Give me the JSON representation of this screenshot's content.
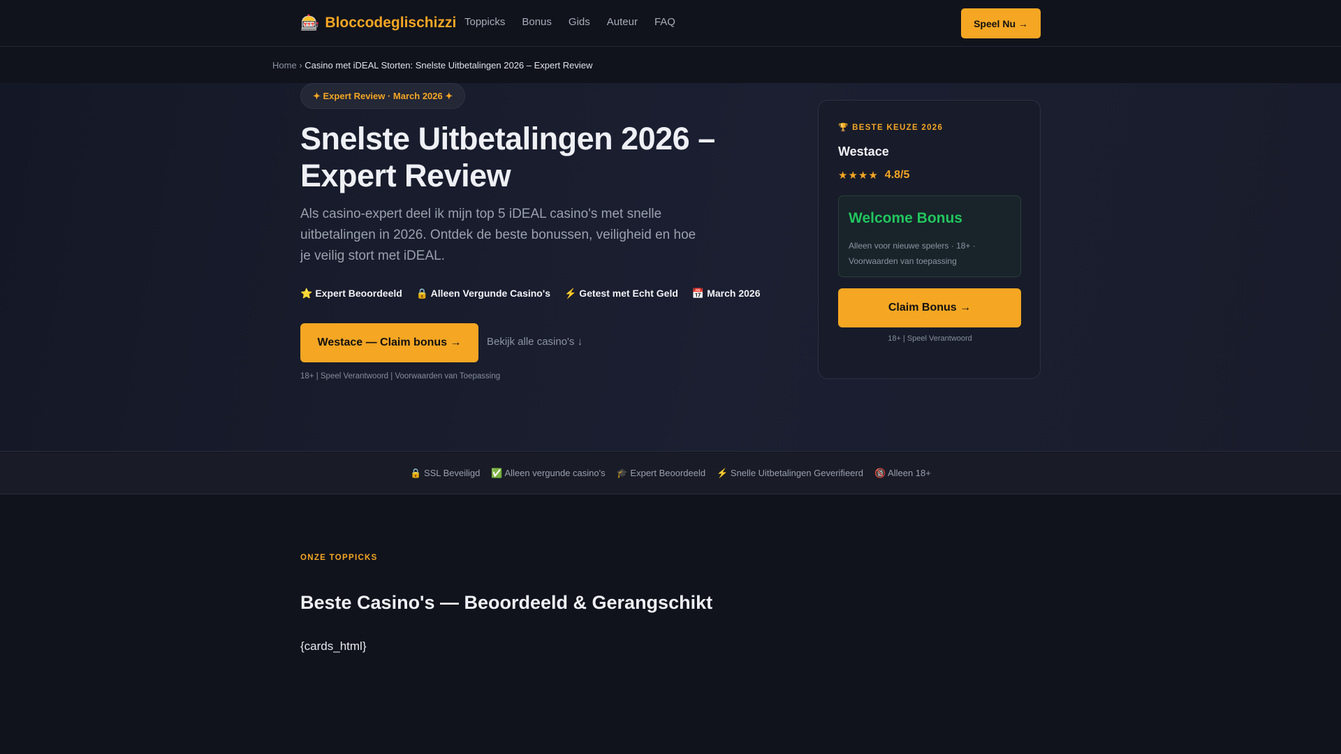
{
  "header": {
    "logo_icon": "🎰",
    "logo_text": "Bloccodeglischizzi",
    "nav": [
      "Toppicks",
      "Bonus",
      "Gids",
      "Auteur",
      "FAQ"
    ],
    "cta": "Speel Nu →"
  },
  "breadcrumb": {
    "home": "Home",
    "separator": "›",
    "current": "Casino met iDEAL Storten: Snelste Uitbetalingen 2026 – Expert Review"
  },
  "hero": {
    "badge": "✦ Expert Review · March 2026 ✦",
    "title": "Snelste Uitbetalingen 2026 – Expert Review",
    "subtitle": "Als casino-expert deel ik mijn top 5 iDEAL casino's met snelle uitbetalingen in 2026. Ontdek de beste bonussen, veiligheid en hoe je veilig stort met iDEAL.",
    "trust_items": [
      "⭐ Expert Beoordeeld",
      "🔒 Alleen Vergunde Casino's",
      "⚡ Getest met Echt Geld",
      "📅 March 2026"
    ],
    "cta": "Westace — Claim bonus →",
    "view_all": "Bekijk alle casino's ↓",
    "disclaimer": "18+ | Speel Verantwoord | Voorwaarden van Toepassing"
  },
  "top_card": {
    "tag": "🏆 BESTE KEUZE 2026",
    "name": "Westace",
    "stars": "★★★★",
    "score": "4.8/5",
    "bonus_title": "Welcome Bonus",
    "bonus_note": "Alleen voor nieuwe spelers · 18+ · Voorwaarden van toepassing",
    "cta": "Claim Bonus →",
    "note": "18+ | Speel Verantwoord"
  },
  "trust_bar": [
    "🔒 SSL Beveiligd",
    "✅ Alleen vergunde casino's",
    "🎓 Expert Beoordeeld",
    "⚡ Snelle Uitbetalingen Geverifieerd",
    "🔞 Alleen 18+"
  ],
  "section": {
    "tag": "ONZE TOPPICKS",
    "title": "Beste Casino's — Beoordeeld & Gerangschikt",
    "placeholder": "{cards_html}"
  },
  "colors": {
    "accent": "#f5a623",
    "bonus_green": "#22c55e",
    "background": "#10131c"
  }
}
